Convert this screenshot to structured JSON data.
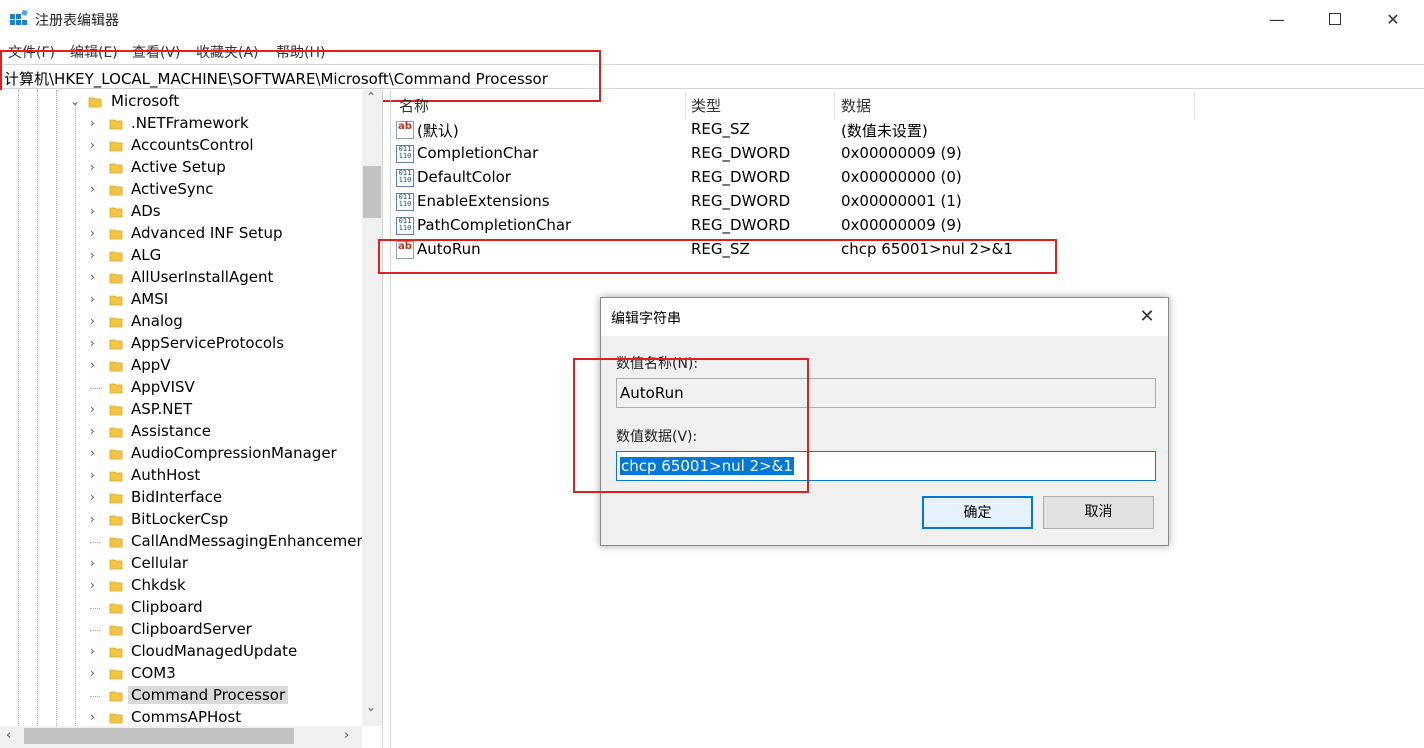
{
  "window": {
    "title": "注册表编辑器"
  },
  "menu": [
    "文件(F)",
    "编辑(E)",
    "查看(V)",
    "收藏夹(A)",
    "帮助(H)"
  ],
  "address": "计算机\\HKEY_LOCAL_MACHINE\\SOFTWARE\\Microsoft\\Command Processor",
  "tree": {
    "parent": "Microsoft",
    "items": [
      ".NETFramework",
      "AccountsControl",
      "Active Setup",
      "ActiveSync",
      "ADs",
      "Advanced INF Setup",
      "ALG",
      "AllUserInstallAgent",
      "AMSI",
      "Analog",
      "AppServiceProtocols",
      "AppV",
      "AppVISV",
      "ASP.NET",
      "Assistance",
      "AudioCompressionManager",
      "AuthHost",
      "BidInterface",
      "BitLockerCsp",
      "CallAndMessagingEnhancement",
      "Cellular",
      "Chkdsk",
      "Clipboard",
      "ClipboardServer",
      "CloudManagedUpdate",
      "COM3",
      "Command Processor",
      "CommsAPHost"
    ],
    "selected": "Command Processor"
  },
  "list": {
    "headers": {
      "name": "名称",
      "type": "类型",
      "data": "数据"
    },
    "rows": [
      {
        "name": "(默认)",
        "type": "REG_SZ",
        "data": "(数值未设置)",
        "icon": "string-value-icon"
      },
      {
        "name": "CompletionChar",
        "type": "REG_DWORD",
        "data": "0x00000009 (9)",
        "icon": "dword-value-icon"
      },
      {
        "name": "DefaultColor",
        "type": "REG_DWORD",
        "data": "0x00000000 (0)",
        "icon": "dword-value-icon"
      },
      {
        "name": "EnableExtensions",
        "type": "REG_DWORD",
        "data": "0x00000001 (1)",
        "icon": "dword-value-icon"
      },
      {
        "name": "PathCompletionChar",
        "type": "REG_DWORD",
        "data": "0x00000009 (9)",
        "icon": "dword-value-icon"
      },
      {
        "name": "AutoRun",
        "type": "REG_SZ",
        "data": "chcp 65001>nul 2>&1",
        "icon": "string-value-icon"
      }
    ]
  },
  "dialog": {
    "title": "编辑字符串",
    "name_label": "数值名称(N):",
    "name_value": "AutoRun",
    "data_label": "数值数据(V):",
    "data_value": "chcp 65001>nul 2>&1",
    "ok_label": "确定",
    "cancel_label": "取消"
  },
  "colors": {
    "highlight": "#e02020",
    "selection": "#0078d7"
  }
}
